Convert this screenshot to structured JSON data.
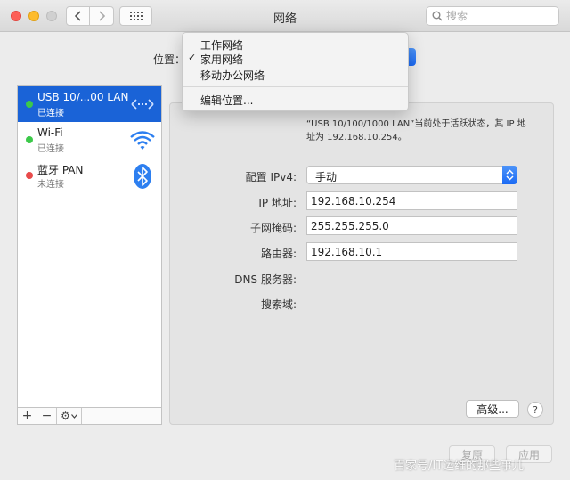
{
  "window": {
    "title": "网络",
    "search_placeholder": "搜索"
  },
  "location": {
    "label": "位置："
  },
  "location_menu": {
    "items": [
      {
        "label": "工作网络",
        "checked": false
      },
      {
        "label": "家用网络",
        "checked": true
      },
      {
        "label": "移动办公网络",
        "checked": false
      }
    ],
    "edit_label": "编辑位置...",
    "checkmark": "✓"
  },
  "services": [
    {
      "name": "USB 10/...00 LAN",
      "status": "已连接",
      "dot_color": "#3cc94a",
      "icon": "ethernet-arrows-icon",
      "selected": true
    },
    {
      "name": "Wi-Fi",
      "status": "已连接",
      "dot_color": "#3cc94a",
      "icon": "wifi-icon",
      "selected": false
    },
    {
      "name": "蓝牙 PAN",
      "status": "未连接",
      "dot_color": "#e84b4b",
      "icon": "bluetooth-icon",
      "selected": false
    }
  ],
  "sidebar_toolbar": {
    "add": "+",
    "remove": "−",
    "gear": "⚙"
  },
  "detail": {
    "description": "“USB 10/100/1000 LAN”当前处于活跃状态，其 IP 地址为 192.168.10.254。",
    "configure_label": "配置 IPv4:",
    "configure_value": "手动",
    "ip_label": "IP 地址:",
    "ip_value": "192.168.10.254",
    "subnet_label": "子网掩码:",
    "subnet_value": "255.255.255.0",
    "router_label": "路由器:",
    "router_value": "192.168.10.1",
    "dns_label": "DNS 服务器:",
    "search_domain_label": "搜索域:"
  },
  "buttons": {
    "advanced": "高级...",
    "help": "?",
    "revert": "复原",
    "apply": "应用"
  },
  "watermark": "百家号/IT运维的那些事儿",
  "colors": {
    "accent": "#1a63d7",
    "connected": "#3cc94a",
    "disconnected": "#e84b4b"
  }
}
